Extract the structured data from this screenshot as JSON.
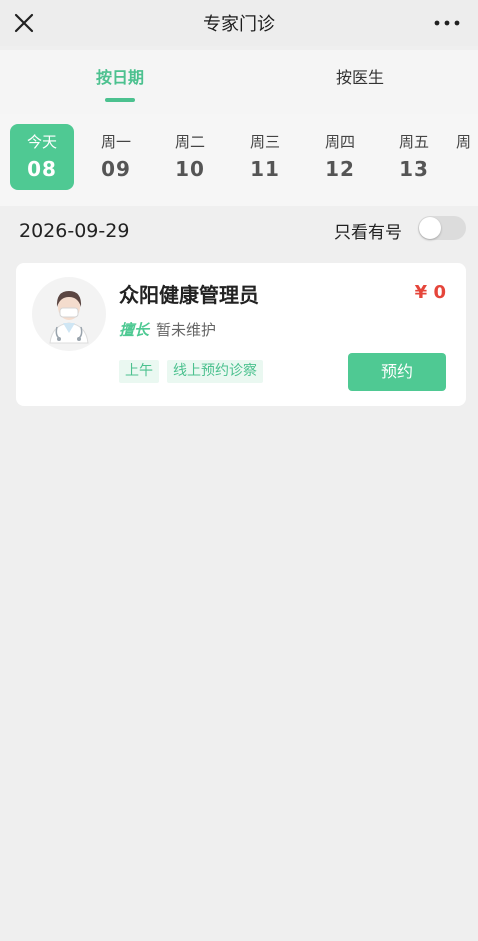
{
  "nav": {
    "title": "专家门诊"
  },
  "tabs": [
    {
      "label": "按日期",
      "active": true
    },
    {
      "label": "按医生",
      "active": false
    }
  ],
  "dates": [
    {
      "weekday": "今天",
      "date": "08",
      "active": true
    },
    {
      "weekday": "周一",
      "date": "09"
    },
    {
      "weekday": "周二",
      "date": "10"
    },
    {
      "weekday": "周三",
      "date": "11"
    },
    {
      "weekday": "周四",
      "date": "12"
    },
    {
      "weekday": "周五",
      "date": "13"
    },
    {
      "weekday": "周",
      "date": ""
    }
  ],
  "selected_date": "2026-09-29",
  "filter": {
    "label": "只看有号",
    "on": false
  },
  "doctor": {
    "name": "众阳健康管理员",
    "price": "¥ 0",
    "specialty_tag": "擅长",
    "specialty_text": "暂未维护",
    "chips": [
      "上午",
      "线上预约诊察"
    ],
    "book_label": "预约"
  },
  "colors": {
    "accent": "#4fc993",
    "price": "#e5453a"
  }
}
